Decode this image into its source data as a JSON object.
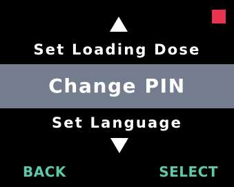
{
  "status": {
    "indicator_color": "#e8344f"
  },
  "menu": {
    "up_arrow_icon": "triangle-up",
    "down_arrow_icon": "triangle-down",
    "previous_item": "Set Loading Dose",
    "selected_item": "Change PIN",
    "next_item": "Set Language",
    "highlight_color": "#747d8f"
  },
  "softkeys": {
    "left_label": "BACK",
    "right_label": "SELECT",
    "color": "#5ec8a8"
  }
}
